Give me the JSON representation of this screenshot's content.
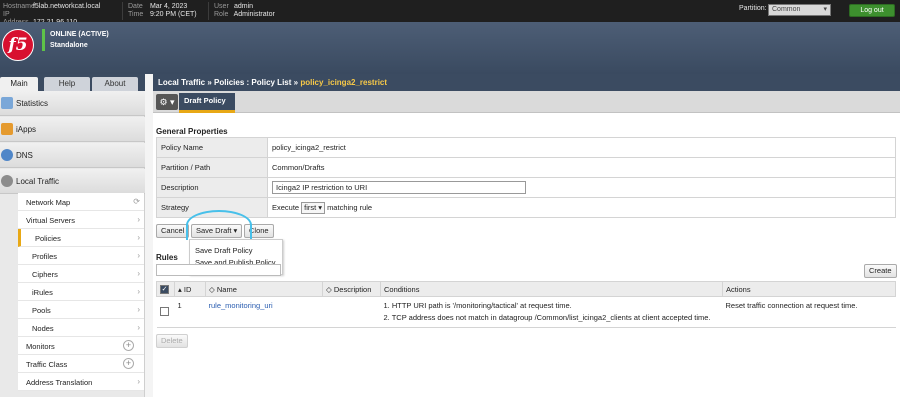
{
  "top": {
    "hostname_label": "Hostname",
    "hostname": "f5lab.networkcat.local",
    "ip_label": "IP Address",
    "ip": "172.21.96.110",
    "date_label": "Date",
    "date": "Mar 4, 2023",
    "time_label": "Time",
    "time": "9:20 PM (CET)",
    "user_label": "User",
    "user": "admin",
    "role_label": "Role",
    "role": "Administrator",
    "partition_label": "Partition:",
    "partition_value": "Common",
    "logout": "Log out"
  },
  "header": {
    "status_line1": "ONLINE (ACTIVE)",
    "status_line2": "Standalone",
    "logo_text": "f5"
  },
  "tabs": [
    "Main",
    "Help",
    "About"
  ],
  "sidebar": {
    "sections": [
      "Statistics",
      "iApps",
      "DNS",
      "Local Traffic"
    ],
    "items": [
      "Network Map",
      "Virtual Servers",
      "Policies",
      "Profiles",
      "Ciphers",
      "iRules",
      "Pools",
      "Nodes",
      "Monitors",
      "Traffic Class",
      "Address Translation"
    ]
  },
  "breadcrumb": {
    "part1": "Local Traffic",
    "sep": "»",
    "part2": "Policies : Policy List",
    "current": "policy_icinga2_restrict"
  },
  "toolbar": {
    "gear": "⚙ ▾",
    "draft_tab": "Draft Policy"
  },
  "general": {
    "heading": "General Properties",
    "rows": [
      {
        "label": "Policy Name",
        "value": "policy_icinga2_restrict"
      },
      {
        "label": "Partition / Path",
        "value": "Common/Drafts"
      },
      {
        "label": "Description",
        "value": "Icinga2 IP restriction to URI"
      },
      {
        "label": "Strategy",
        "prefix": "Execute",
        "select": "first",
        "suffix": "matching rule"
      }
    ]
  },
  "actions": {
    "cancel": "Cancel",
    "save_draft": "Save Draft",
    "clone": "Clone"
  },
  "dropdown": [
    "Save Draft Policy",
    "Save and Publish Policy"
  ],
  "rules": {
    "heading": "Rules",
    "create": "Create",
    "columns": [
      "ID",
      "Name",
      "Description",
      "Conditions",
      "Actions"
    ],
    "row": {
      "id": "1",
      "name": "rule_monitoring_uri",
      "description": "",
      "conditions": [
        "1. HTTP URI path is '/monitoring/tactical' at request time.",
        "2. TCP address does not match in datagroup /Common/list_icinga2_clients at client accepted time."
      ],
      "action": "Reset traffic connection at request time."
    },
    "delete": "Delete"
  }
}
